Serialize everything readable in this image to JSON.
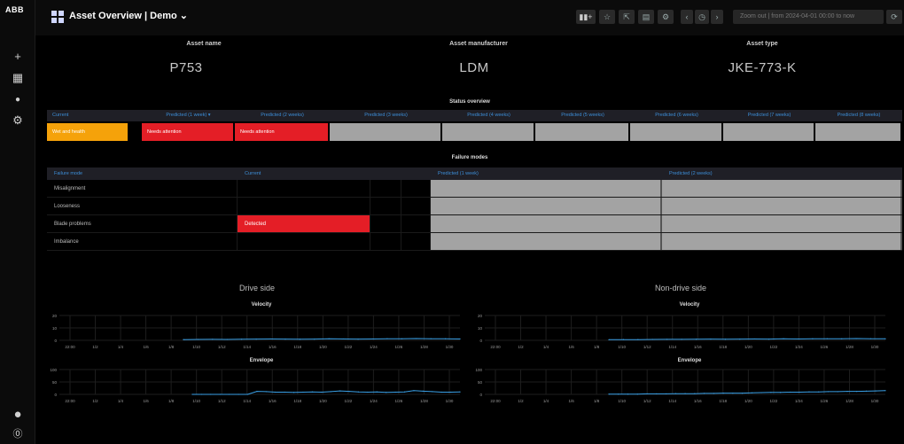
{
  "app": {
    "logo": "ABB",
    "title": "Asset Overview | Demo ⌄"
  },
  "sidebar": {
    "items": [
      {
        "name": "add-icon",
        "glyph": "+"
      },
      {
        "name": "dashboards-icon",
        "glyph": "▦"
      },
      {
        "name": "bell-icon",
        "glyph": "●"
      },
      {
        "name": "gear-icon",
        "glyph": "⚙"
      }
    ],
    "bottom": [
      {
        "name": "user-avatar-icon",
        "glyph": "●"
      },
      {
        "name": "help-icon",
        "glyph": "⓪"
      }
    ]
  },
  "toolbar": {
    "buttons": [
      "▮▮+",
      "☆",
      "⇱",
      "▤",
      "⚙",
      "‹",
      "◷",
      "›",
      "⟳"
    ],
    "time_range": "Zoom out | from 2024-04-01 00:00 to now"
  },
  "asset": {
    "name_label": "Asset name",
    "name": "P753",
    "manufacturer_label": "Asset manufacturer",
    "manufacturer": "LDM",
    "type_label": "Asset type",
    "type": "JKE-773-K"
  },
  "status_overview": {
    "title": "Status overview",
    "headers": [
      "Current",
      "Predicted (1 week) ▾",
      "Predicted (2 weeks)",
      "Predicted (3 weeks)",
      "Predicted (4 weeks)",
      "Predicted (5 weeks)",
      "Predicted (6 weeks)",
      "Predicted (7 weeks)",
      "Predicted (8 weeks)"
    ],
    "row": [
      {
        "text": "Wet and health",
        "color": "#f5a20a"
      },
      {
        "text": "",
        "color": "#000000"
      },
      {
        "text": "Needs attention",
        "color": "#e41e26"
      },
      {
        "text": "Needs attention",
        "color": "#e41e26"
      },
      {
        "text": "",
        "color": "#a3a3a3"
      },
      {
        "text": "",
        "color": "#a3a3a3"
      },
      {
        "text": "",
        "color": "#a3a3a3"
      },
      {
        "text": "",
        "color": "#a3a3a3"
      },
      {
        "text": "",
        "color": "#a3a3a3"
      },
      {
        "text": "",
        "color": "#a3a3a3"
      }
    ]
  },
  "failure_modes": {
    "title": "Failure modes",
    "headers": [
      "Failure mode",
      "Current",
      "Predicted (1 week)",
      "Predicted (2 weeks)"
    ],
    "rows": [
      {
        "mode": "Misalignment",
        "current": "",
        "detected": false
      },
      {
        "mode": "Looseness",
        "current": "",
        "detected": false
      },
      {
        "mode": "Blade problems",
        "current": "Detected",
        "detected": true
      },
      {
        "mode": "Imbalance",
        "current": "",
        "detected": false
      }
    ],
    "detected_color": "#e41e26"
  },
  "drive_side": {
    "title": "Drive side",
    "velocity_title": "Velocity",
    "envelope_title": "Envelope",
    "velocity_yticks": [
      "20",
      "10",
      "0"
    ],
    "envelope_yticks": [
      "100",
      "50",
      "0"
    ],
    "xticks": [
      "22:00",
      "1/2",
      "1/4",
      "1/6",
      "1/8",
      "1/10",
      "1/12",
      "1/14",
      "1/16",
      "1/18",
      "1/20",
      "1/22",
      "1/24",
      "1/26",
      "1/28",
      "1/30"
    ]
  },
  "non_drive_side": {
    "title": "Non-drive side",
    "velocity_title": "Velocity",
    "envelope_title": "Envelope",
    "velocity_yticks": [
      "20",
      "10",
      "0"
    ],
    "envelope_yticks": [
      "100",
      "50",
      "0"
    ],
    "xticks": [
      "22:00",
      "1/2",
      "1/4",
      "1/6",
      "1/8",
      "1/10",
      "1/12",
      "1/14",
      "1/16",
      "1/18",
      "1/20",
      "1/22",
      "1/24",
      "1/26",
      "1/28",
      "1/30"
    ]
  },
  "chart_data": [
    {
      "type": "line",
      "title": "Velocity",
      "xlabel": "",
      "ylabel": "",
      "ylim": [
        0,
        20
      ],
      "series": [
        {
          "values": [
            0.6,
            0.7,
            0.8,
            0.7,
            0.9,
            1.0,
            1.1,
            1.0,
            0.9,
            1.0,
            1.2,
            1.1,
            1.0,
            1.1,
            1.3,
            1.2,
            1.4,
            1.3,
            1.2,
            1.1
          ]
        }
      ]
    },
    {
      "type": "line",
      "title": "Envelope",
      "xlabel": "",
      "ylabel": "",
      "ylim": [
        0,
        100
      ],
      "series": [
        {
          "values": [
            0,
            0,
            0,
            0,
            0,
            0,
            0,
            12,
            11,
            9,
            9,
            8,
            9,
            10,
            9,
            11,
            14,
            12,
            10,
            9,
            10,
            8,
            9,
            10,
            15,
            13,
            11,
            9,
            9,
            10
          ]
        }
      ]
    },
    {
      "type": "line",
      "title": "Velocity",
      "xlabel": "",
      "ylabel": "",
      "ylim": [
        0,
        20
      ],
      "series": [
        {
          "values": [
            0.5,
            0.6,
            0.6,
            0.7,
            0.8,
            0.8,
            0.9,
            1.0,
            0.9,
            1.0,
            1.1,
            1.0,
            1.2,
            1.1,
            1.2,
            1.3,
            1.2,
            1.4,
            1.3,
            1.2
          ]
        }
      ]
    },
    {
      "type": "line",
      "title": "Envelope",
      "xlabel": "",
      "ylabel": "",
      "ylim": [
        0,
        100
      ],
      "series": [
        {
          "values": [
            1,
            1,
            1,
            1,
            2,
            2,
            2,
            3,
            3,
            3,
            4,
            4,
            5,
            5,
            5,
            6,
            7,
            8,
            8,
            9,
            9,
            10,
            10,
            11,
            11,
            12,
            12,
            13,
            14,
            15
          ]
        }
      ]
    }
  ]
}
